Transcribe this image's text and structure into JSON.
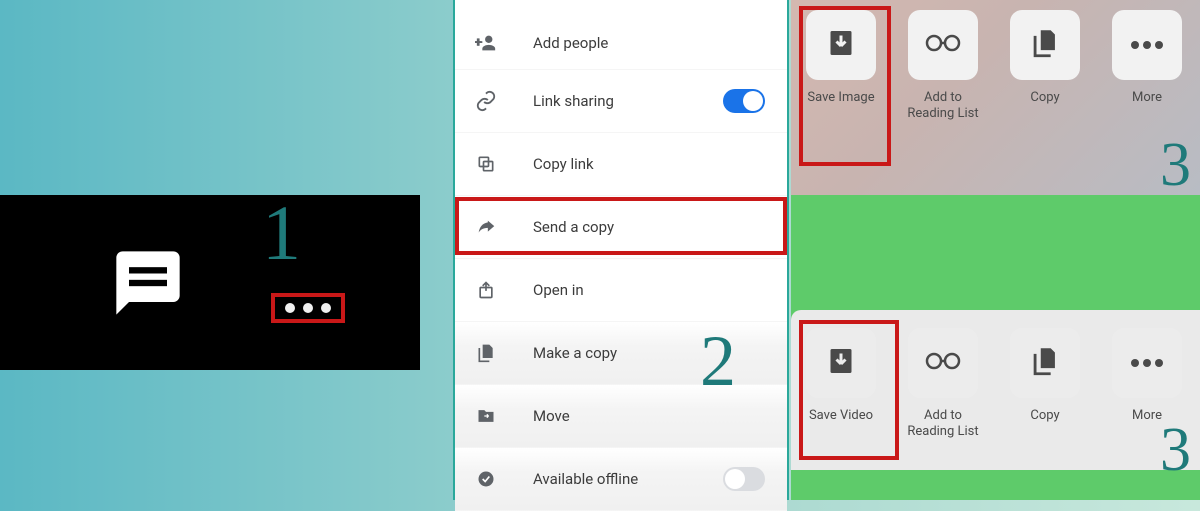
{
  "steps": {
    "one": "1",
    "two": "2",
    "three_a": "3",
    "three_b": "3"
  },
  "menu": {
    "add_people": "Add people",
    "link_sharing": "Link sharing",
    "copy_link": "Copy link",
    "send_copy": "Send a copy",
    "open_in": "Open in",
    "make_copy": "Make a copy",
    "move": "Move",
    "available_offline": "Available offline"
  },
  "share_a": {
    "save": "Save Image",
    "reading": "Add to Reading List",
    "copy": "Copy",
    "more": "More"
  },
  "share_b": {
    "save": "Save Video",
    "reading": "Add to Reading List",
    "copy": "Copy",
    "more": "More"
  }
}
